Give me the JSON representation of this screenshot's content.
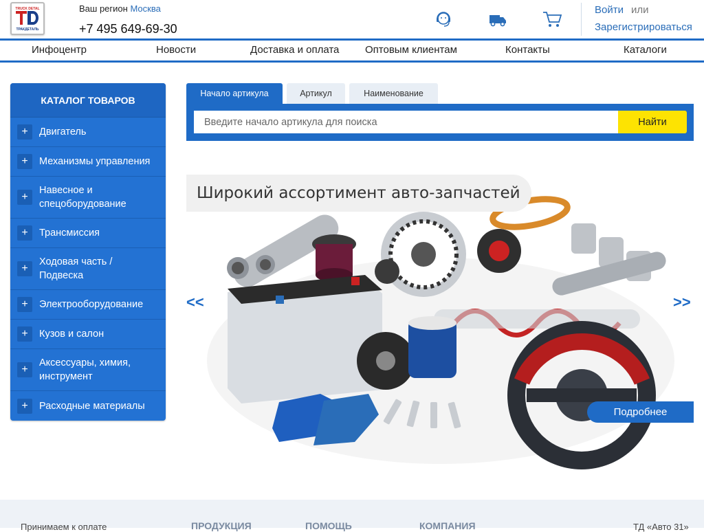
{
  "header": {
    "logo_text": "ТД ТРАКДЕТАЛЬ",
    "region_label": "Ваш регион",
    "region_city": "Москва",
    "phone": "+7 495 649-69-30",
    "icons": [
      "support-headset-icon",
      "delivery-truck-icon",
      "cart-icon"
    ],
    "login": "Войти",
    "or": "или",
    "register": "Зарегистрироваться"
  },
  "nav": {
    "items": [
      "Инфоцентр",
      "Новости",
      "Доставка и оплата",
      "Оптовым клиентам",
      "Контакты",
      "Каталоги"
    ]
  },
  "catalog": {
    "title": "КАТАЛОГ ТОВАРОВ",
    "items": [
      {
        "label": "Двигатель",
        "lines": [
          "Двигатель"
        ]
      },
      {
        "label": "Механизмы управления",
        "lines": [
          "Механизмы управления"
        ]
      },
      {
        "label": "Навесное и спецоборудование",
        "lines": [
          "Навесное и",
          "спецоборудование"
        ]
      },
      {
        "label": "Трансмиссия",
        "lines": [
          "Трансмиссия"
        ]
      },
      {
        "label": "Ходовая часть / Подвеска",
        "lines": [
          "Ходовая часть /",
          "Подвеска"
        ]
      },
      {
        "label": "Электрооборудование",
        "lines": [
          "Электрооборудование"
        ]
      },
      {
        "label": "Кузов и салон",
        "lines": [
          "Кузов и салон"
        ]
      },
      {
        "label": "Аксессуары, химия, инструмент",
        "lines": [
          "Аксессуары, химия,",
          "инструмент"
        ]
      },
      {
        "label": "Расходные материалы",
        "lines": [
          "Расходные материалы"
        ]
      }
    ]
  },
  "search": {
    "tabs": [
      "Начало артикула",
      "Артикул",
      "Наименование"
    ],
    "active_tab": "Начало артикула",
    "placeholder": "Введите начало артикула для поиска",
    "value": "",
    "button": "Найти"
  },
  "slider": {
    "caption": "Широкий ассортимент авто-запчастей",
    "prev": "<<",
    "next": ">>",
    "more_button": "Подробнее"
  },
  "footer": {
    "payment": "Принимаем к оплате",
    "col1": "ПРОДУКЦИЯ",
    "col2": "ПОМОЩЬ",
    "col3": "КОМПАНИЯ",
    "copyright": "ТД «Авто 31»"
  },
  "colors": {
    "primary": "#1f6bc6",
    "search_button": "#fde302",
    "link": "#2a6db8"
  }
}
